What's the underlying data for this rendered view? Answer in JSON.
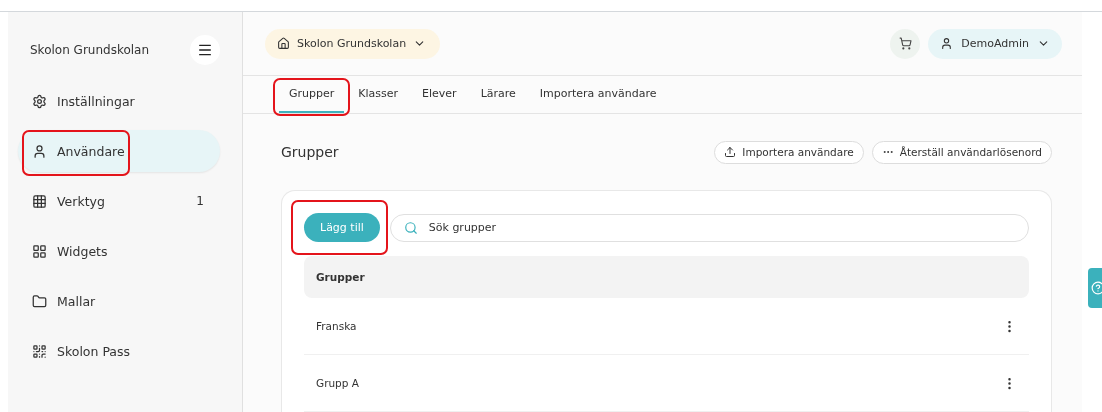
{
  "sidebar": {
    "title": "Skolon Grundskolan",
    "items": [
      {
        "label": "Inställningar",
        "selected": false,
        "highlighted": false
      },
      {
        "label": "Användare",
        "selected": true,
        "highlighted": true
      },
      {
        "label": "Verktyg",
        "count": "1",
        "selected": false,
        "highlighted": false
      },
      {
        "label": "Widgets",
        "selected": false,
        "highlighted": false
      },
      {
        "label": "Mallar",
        "selected": false,
        "highlighted": false
      },
      {
        "label": "Skolon Pass",
        "selected": false,
        "highlighted": false
      }
    ]
  },
  "header": {
    "school": "Skolon Grundskolan",
    "user": "DemoAdmin"
  },
  "tabs": [
    {
      "label": "Grupper",
      "selected": true,
      "highlighted": true
    },
    {
      "label": "Klasser",
      "selected": false,
      "highlighted": false
    },
    {
      "label": "Elever",
      "selected": false,
      "highlighted": false
    },
    {
      "label": "Lärare",
      "selected": false,
      "highlighted": false
    },
    {
      "label": "Importera användare",
      "selected": false,
      "highlighted": false
    }
  ],
  "section": {
    "title": "Grupper",
    "actions": [
      {
        "label": "Importera användare"
      },
      {
        "label": "Återställ användarlösenord"
      }
    ]
  },
  "add_button": {
    "label": "Lägg till",
    "highlighted": true
  },
  "search": {
    "placeholder": "Sök grupper"
  },
  "table": {
    "columns": [
      "Grupper"
    ],
    "rows": [
      [
        "Franska"
      ],
      [
        "Grupp A"
      ]
    ]
  }
}
